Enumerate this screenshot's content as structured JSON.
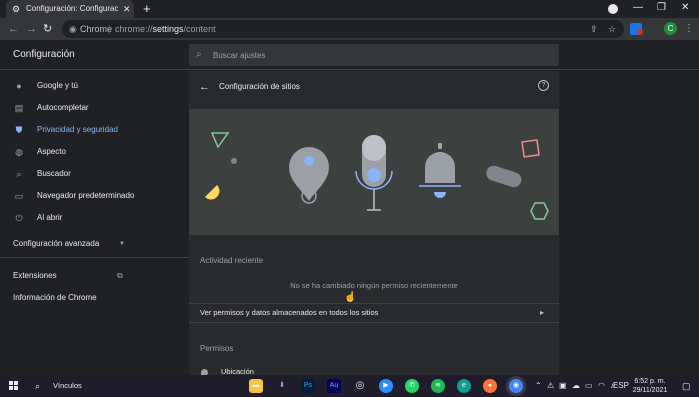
{
  "browser": {
    "tab_title": "Configuración: Configuración de",
    "site_label": "Chrome",
    "url_prefix": "chrome://",
    "url_path": "settings",
    "url_suffix": "/content",
    "profile_initial": "C"
  },
  "settings": {
    "title": "Configuración",
    "search_placeholder": "Buscar ajustes",
    "sidebar": [
      {
        "label": "Google y tú",
        "icon": "person-icon",
        "active": false
      },
      {
        "label": "Autocompletar",
        "icon": "autofill-icon",
        "active": false
      },
      {
        "label": "Privacidad y seguridad",
        "icon": "shield-icon",
        "active": true
      },
      {
        "label": "Aspecto",
        "icon": "palette-icon",
        "active": false
      },
      {
        "label": "Buscador",
        "icon": "search-icon",
        "active": false
      },
      {
        "label": "Navegador predeterminado",
        "icon": "browser-icon",
        "active": false
      },
      {
        "label": "Al abrir",
        "icon": "power-icon",
        "active": false
      }
    ],
    "advanced_label": "Configuración avanzada",
    "extensions_label": "Extensiones",
    "about_label": "Información de Chrome"
  },
  "panel": {
    "title": "Configuración de sitios",
    "recent_activity_label": "Actividad reciente",
    "no_changes_text": "No se ha cambiado ningún permiso recientemente",
    "view_permissions_label": "Ver permisos y datos almacenados en todos los sitios",
    "permissions_label": "Permisos",
    "location_label": "Ubicación"
  },
  "taskbar": {
    "search_label": "Vínculos",
    "language": "ESP",
    "time": "6:52 p. m.",
    "date": "29/11/2021",
    "apps": [
      "file-explorer",
      "terminal",
      "photoshop",
      "audition",
      "obs",
      "zoom",
      "whatsapp",
      "spotify",
      "edge",
      "firefox",
      "chrome"
    ]
  },
  "colors": {
    "accent": "#8ab4f8",
    "background": "#202124",
    "panel": "#292a2d",
    "banner": "#3c403f"
  }
}
